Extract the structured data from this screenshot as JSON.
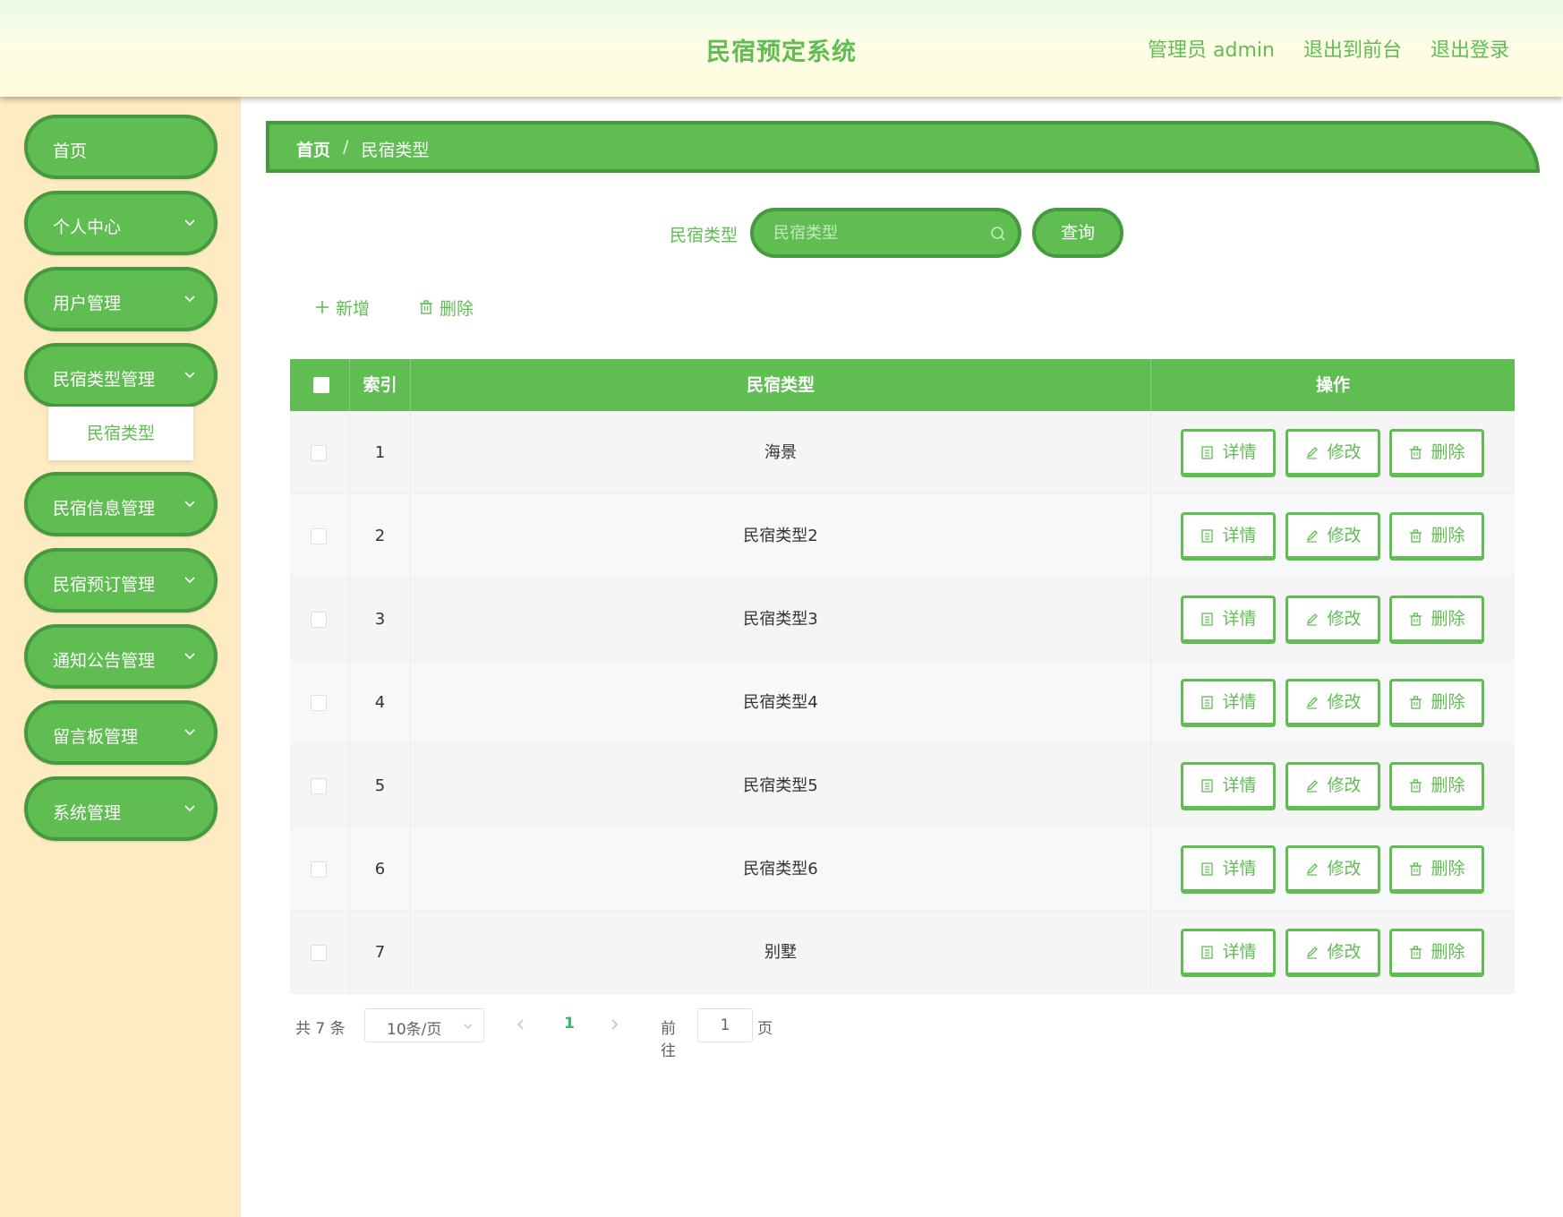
{
  "header": {
    "title": "民宿预定系统",
    "links": [
      "管理员 admin",
      "退出到前台",
      "退出登录"
    ]
  },
  "sidebar": {
    "items": [
      {
        "label": "首页"
      },
      {
        "label": "个人中心"
      },
      {
        "label": "用户管理"
      },
      {
        "label": "民宿类型管理"
      },
      {
        "label": "民宿信息管理"
      },
      {
        "label": "民宿预订管理"
      },
      {
        "label": "通知公告管理"
      },
      {
        "label": "留言板管理"
      },
      {
        "label": "系统管理"
      }
    ],
    "submenu": {
      "label": "民宿类型"
    }
  },
  "breadcrumb": {
    "home": "首页",
    "separator": "/",
    "current": "民宿类型"
  },
  "search": {
    "label": "民宿类型",
    "placeholder": "民宿类型",
    "button": "查询"
  },
  "actions": {
    "add": "新增",
    "delete": "删除"
  },
  "table": {
    "headers": [
      "索引",
      "民宿类型",
      "操作"
    ],
    "rows": [
      {
        "index": "1",
        "type": "海景"
      },
      {
        "index": "2",
        "type": "民宿类型2"
      },
      {
        "index": "3",
        "type": "民宿类型3"
      },
      {
        "index": "4",
        "type": "民宿类型4"
      },
      {
        "index": "5",
        "type": "民宿类型5"
      },
      {
        "index": "6",
        "type": "民宿类型6"
      },
      {
        "index": "7",
        "type": "别墅"
      }
    ],
    "row_buttons": {
      "detail": "详情",
      "edit": "修改",
      "delete": "删除"
    }
  },
  "pagination": {
    "total": "共 7 条",
    "page_size": "10条/页",
    "current_page": "1",
    "goto_label": "前往",
    "goto_value": "1",
    "page_suffix": "页"
  },
  "colors": {
    "primary": "#5fbd52",
    "primary_dark": "#449a3c",
    "sidebar_bg": "#ffebc2",
    "header_bg": "#fefde6"
  }
}
